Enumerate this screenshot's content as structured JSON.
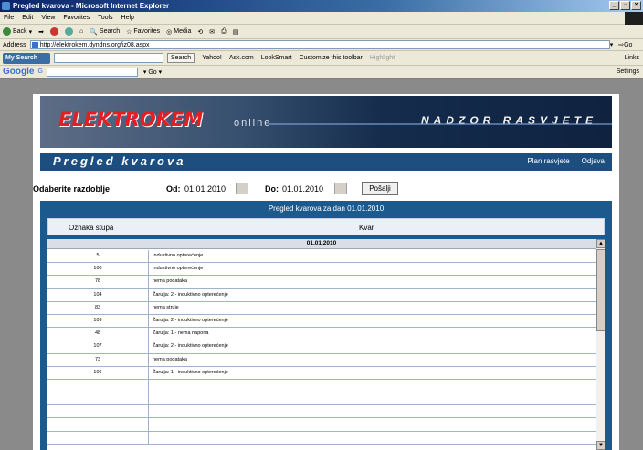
{
  "window": {
    "title": "Pregled kvarova - Microsoft Internet Explorer"
  },
  "menu": [
    "File",
    "Edit",
    "View",
    "Favorites",
    "Tools",
    "Help"
  ],
  "toolbar": {
    "back": "Back",
    "search": "Search",
    "favorites": "Favorites",
    "media": "Media"
  },
  "address": {
    "label": "Address",
    "url": "http://elektrokem.dyndns.org/iz08.aspx",
    "go": "Go",
    "links": "Links"
  },
  "searchbar": {
    "logo": "My Search",
    "search_btn": "Search",
    "yahoo": "Yahoo!",
    "ask": "Ask.com",
    "looksmart": "LookSmart",
    "customize": "Customize this toolbar",
    "highlight": "Highlight"
  },
  "googlebar": {
    "logo": "Google",
    "g": "G",
    "settings": "Settings"
  },
  "banner": {
    "logo": "ELEKTROKEM",
    "online": "online",
    "title": "NADZOR RASVJETE"
  },
  "header": {
    "title": "Pregled kvarova",
    "link_plan": "Plan rasvjete",
    "link_logout": "Odjava"
  },
  "filter": {
    "label": "Odaberite razdoblje",
    "from_label": "Od:",
    "from_value": "01.01.2010",
    "to_label": "Do:",
    "to_value": "01.01.2010",
    "send": "Pošalji"
  },
  "panel": {
    "title": "Pregled kvarova za dan 01.01.2010",
    "col1": "Oznaka stupa",
    "col2": "Kvar",
    "group_date": "01.01.2010"
  },
  "rows": [
    {
      "id": "5",
      "fault": "Induktivno opterećenje"
    },
    {
      "id": "100",
      "fault": "Induktivno opterećenje"
    },
    {
      "id": "78",
      "fault": "nema podataka"
    },
    {
      "id": "104",
      "fault": "Žarulja: 2 - induktivno opterećenje"
    },
    {
      "id": "83",
      "fault": "nema struje"
    },
    {
      "id": "109",
      "fault": "Žarulja: 2 - induktivno opterećenje"
    },
    {
      "id": "48",
      "fault": "Žarulja: 1 - nema napona"
    },
    {
      "id": "107",
      "fault": "Žarulja: 2 - induktivno opterećenje"
    },
    {
      "id": "73",
      "fault": "nema podataka"
    },
    {
      "id": "106",
      "fault": "Žarulja: 1 - induktivno opterećenje"
    },
    {
      "id": "",
      "fault": ""
    },
    {
      "id": "",
      "fault": ""
    },
    {
      "id": "",
      "fault": ""
    },
    {
      "id": "",
      "fault": ""
    },
    {
      "id": "",
      "fault": ""
    }
  ]
}
